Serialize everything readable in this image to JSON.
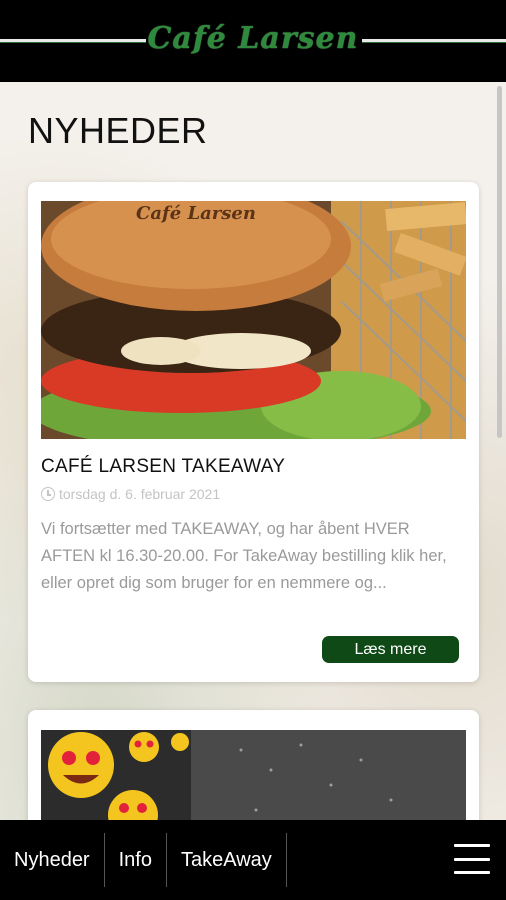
{
  "header": {
    "brand": "Café Larsen"
  },
  "page": {
    "title": "NYHEDER"
  },
  "articles": [
    {
      "image_icon": "burger-fries-photo",
      "title": "CAFÉ LARSEN TAKEAWAY",
      "date": "torsdag d. 6. februar 2021",
      "excerpt": "Vi fortsætter med TAKEAWAY, og har åbent HVER AFTEN kl 16.30-20.00.  For TakeAway bestilling klik her, eller opret dig som bruger for en nemmere og...",
      "read_more_label": "Læs mere"
    },
    {
      "image_icon": "emoji-grill-photo"
    }
  ],
  "bottom_nav": {
    "items": [
      "Nyheder",
      "Info",
      "TakeAway"
    ],
    "menu_icon": "hamburger-menu-icon"
  },
  "colors": {
    "header_bg": "#000000",
    "brand_green": "#2f8a3d",
    "button_green": "#0f4a16"
  }
}
